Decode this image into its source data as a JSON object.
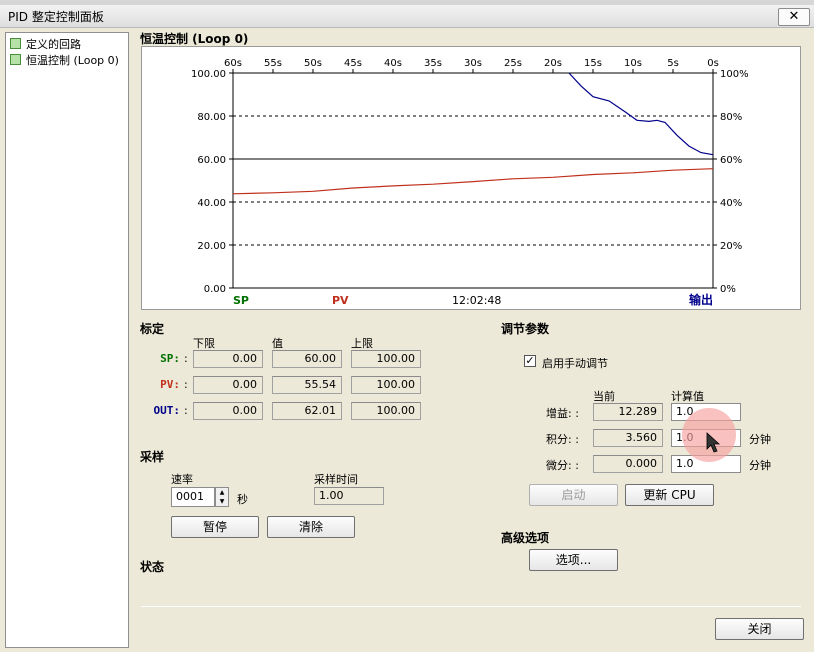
{
  "window": {
    "title": "PID 整定控制面板",
    "close_glyph": "✕"
  },
  "tree": {
    "items": [
      "定义的回路",
      "恒温控制 (Loop 0)"
    ]
  },
  "chart": {
    "title": "恒温控制 (Loop 0)"
  },
  "chart_data": {
    "type": "line",
    "x_ticks": [
      "60s",
      "55s",
      "50s",
      "45s",
      "40s",
      "35s",
      "30s",
      "25s",
      "20s",
      "15s",
      "10s",
      "5s",
      "0s"
    ],
    "left_ticks": [
      "100.00",
      "80.00",
      "60.00",
      "40.00",
      "20.00",
      "0.00"
    ],
    "right_ticks": [
      "100%",
      "80%",
      "60%",
      "40%",
      "20%",
      "0%"
    ],
    "ylim": [
      0,
      100
    ],
    "xlim": [
      60,
      0
    ],
    "grid": "dashed-horizontal",
    "legend": {
      "sp": "SP",
      "pv": "PV",
      "time": "12:02:48",
      "out": "输出"
    },
    "colors": {
      "sp": "#007000",
      "pv": "#c0301c",
      "out": "#00008b"
    },
    "series": [
      {
        "name": "PV",
        "color": "#c0301c",
        "points": [
          [
            60,
            43.8
          ],
          [
            55,
            44.3
          ],
          [
            50,
            45
          ],
          [
            45,
            46.5
          ],
          [
            40,
            47.5
          ],
          [
            35,
            48.3
          ],
          [
            30,
            49.5
          ],
          [
            25,
            50.8
          ],
          [
            20,
            51.5
          ],
          [
            15,
            52.8
          ],
          [
            10,
            53.6
          ],
          [
            5,
            54.8
          ],
          [
            0,
            55.5
          ]
        ]
      },
      {
        "name": "输出",
        "color": "#00008b",
        "points": [
          [
            18,
            100
          ],
          [
            16.5,
            94
          ],
          [
            15,
            89
          ],
          [
            13,
            87
          ],
          [
            11,
            82
          ],
          [
            9.5,
            78
          ],
          [
            8,
            77.5
          ],
          [
            7,
            78
          ],
          [
            6,
            77
          ],
          [
            4.5,
            71
          ],
          [
            3,
            66
          ],
          [
            1.5,
            63
          ],
          [
            0,
            62
          ]
        ]
      }
    ]
  },
  "calibration": {
    "heading": "标定",
    "col_low": "下限",
    "col_val": "值",
    "col_high": "上限",
    "rows": [
      {
        "label": "SP:",
        "colon": ":",
        "color": "#007000",
        "low": "0.00",
        "val": "60.00",
        "high": "100.00"
      },
      {
        "label": "PV:",
        "colon": ":",
        "color": "#c0301c",
        "low": "0.00",
        "val": "55.54",
        "high": "100.00"
      },
      {
        "label": "OUT:",
        "colon": ":",
        "color": "#00008b",
        "low": "0.00",
        "val": "62.01",
        "high": "100.00"
      }
    ]
  },
  "sampling": {
    "heading": "采样",
    "rate_label": "速率",
    "rate_value": "0001",
    "rate_unit": "秒",
    "time_label": "采样时间",
    "time_value": "1.00",
    "pause_button": "暂停",
    "clear_button": "清除"
  },
  "status": {
    "heading": "状态"
  },
  "tuning": {
    "heading": "调节参数",
    "manual_label": "启用手动调节",
    "manual_checked": "✓",
    "col_current": "当前",
    "col_calc": "计算值",
    "rows": [
      {
        "label": "增益: :",
        "current": "12.289",
        "calc": "1.0",
        "unit": ""
      },
      {
        "label": "积分: :",
        "current": "3.560",
        "calc": "1.0",
        "unit": "分钟"
      },
      {
        "label": "微分: :",
        "current": "0.000",
        "calc": "1.0",
        "unit": "分钟"
      }
    ],
    "start_button": "启动",
    "update_button": "更新 CPU"
  },
  "advanced": {
    "heading": "高级选项",
    "options_button": "选项..."
  },
  "footer": {
    "close_button": "关闭"
  }
}
